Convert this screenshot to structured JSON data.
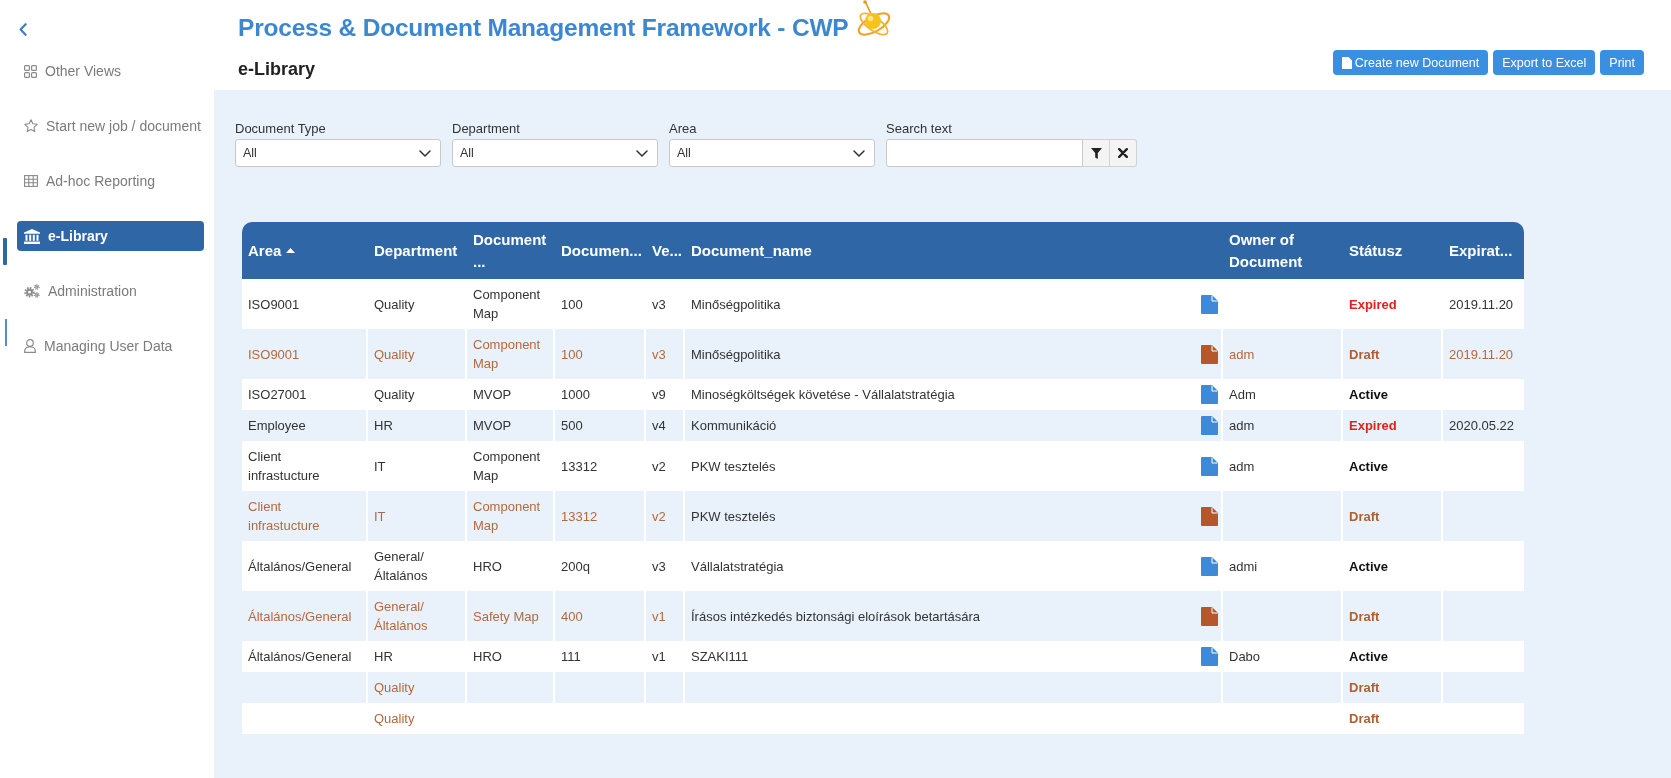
{
  "sidebar": {
    "items": [
      {
        "label": "Other Views",
        "selected": false
      },
      {
        "label": "Start new job / document",
        "selected": false
      },
      {
        "label": "Ad-hoc Reporting",
        "selected": false
      },
      {
        "label": "e-Library",
        "selected": true
      },
      {
        "label": "Administration",
        "selected": false
      },
      {
        "label": "Managing User Data",
        "selected": false
      }
    ]
  },
  "header": {
    "title": "Process & Document Management Framework - CWP",
    "page_title": "e-Library",
    "buttons": [
      {
        "label": "Create new Document",
        "icon": true
      },
      {
        "label": "Export to Excel",
        "icon": false
      },
      {
        "label": "Print",
        "icon": false
      }
    ]
  },
  "filters": [
    {
      "kind": "select",
      "label": "Document Type",
      "value": "All"
    },
    {
      "kind": "select",
      "label": "Department",
      "value": "All"
    },
    {
      "kind": "select",
      "label": "Area",
      "value": "All"
    },
    {
      "kind": "search",
      "label": "Search text"
    }
  ],
  "table": {
    "columns": [
      {
        "label": "Area",
        "sorted": true
      },
      {
        "label": "Department",
        "sorted": false
      },
      {
        "label": "Document ...",
        "sorted": false
      },
      {
        "label": "Documen...",
        "sorted": false
      },
      {
        "label": "Ve...",
        "sorted": false
      },
      {
        "label": "Document_name",
        "sorted": false
      },
      {
        "label": "Owner of Document",
        "sorted": false
      },
      {
        "label": "Státusz",
        "sorted": false
      },
      {
        "label": "Expirat...",
        "sorted": false
      }
    ],
    "rows": [
      {
        "kind": "expired",
        "area": "ISO9001",
        "department": "Quality",
        "column_3": "Component Map",
        "column_4": "100",
        "column_5": "v3",
        "document_name": "Minőségpolitika",
        "file": true,
        "status": "Expired",
        "column_9": "2019.11.20"
      },
      {
        "kind": "draft",
        "area": "ISO9001",
        "department": "Quality",
        "column_3": "Component Map",
        "column_4": "100",
        "column_5": "v3",
        "document_name": "Minőségpolitika",
        "file": true,
        "owner_of_document": "adm",
        "status": "Draft",
        "column_9": "2019.11.20"
      },
      {
        "kind": "active",
        "area": "ISO27001",
        "department": "Quality",
        "column_3": "MVOP",
        "column_4": "1000",
        "column_5": "v9",
        "document_name": "Minoségköltségek követése - Vállalatstratégia",
        "file": true,
        "owner_of_document": "Adm",
        "status": "Active"
      },
      {
        "kind": "expired",
        "area": "Employee",
        "department": "HR",
        "column_3": "MVOP",
        "column_4": "500",
        "column_5": "v4",
        "document_name": "Kommunikáció",
        "file": true,
        "owner_of_document": "adm",
        "status": "Expired",
        "column_9": "2020.05.22"
      },
      {
        "kind": "active",
        "area": "Client infrastucture",
        "department": "IT",
        "column_3": "Component Map",
        "column_4": "13312",
        "column_5": "v2",
        "document_name": "PKW tesztelés",
        "file": true,
        "owner_of_document": "adm",
        "status": "Active"
      },
      {
        "kind": "draft",
        "area": "Client infrastucture",
        "department": "IT",
        "column_3": "Component Map",
        "column_4": "13312",
        "column_5": "v2",
        "document_name": "PKW tesztelés",
        "file": true,
        "status": "Draft"
      },
      {
        "kind": "active",
        "area": "Általános/General",
        "department": "General/ Általános",
        "column_3": "HRO",
        "column_4": "200q",
        "column_5": "v3",
        "document_name": "Vállalatstratégia",
        "file": true,
        "owner_of_document": "admi",
        "status": "Active"
      },
      {
        "kind": "draft",
        "area": "Általános/General",
        "department": "General/ Általános",
        "column_3": "Safety Map",
        "column_4": "400",
        "column_5": "v1",
        "document_name": "Írásos intézkedés biztonsági eloírások betartására",
        "file": true,
        "status": "Draft"
      },
      {
        "kind": "active",
        "area": "Általános/General",
        "department": "HR",
        "column_3": "HRO",
        "column_4": "111",
        "column_5": "v1",
        "document_name": "SZAKI111",
        "file": true,
        "owner_of_document": "Dabo",
        "status": "Active"
      },
      {
        "kind": "draft",
        "department": "Quality",
        "file": false,
        "status": "Draft"
      },
      {
        "kind": "draft",
        "department": "Quality",
        "file": false,
        "status": "Draft"
      }
    ]
  }
}
